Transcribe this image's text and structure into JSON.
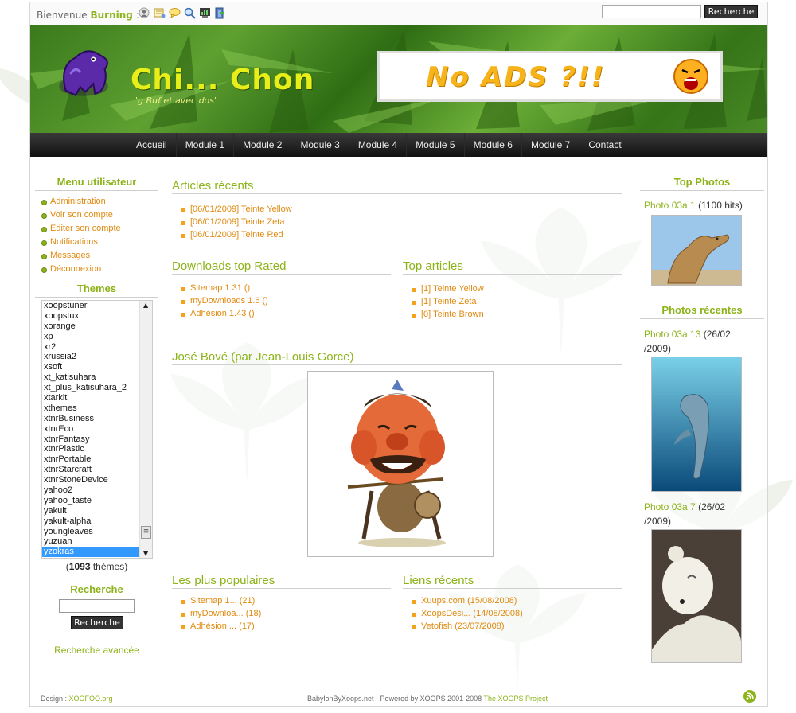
{
  "topbar": {
    "welcome_prefix": "Bienvenue",
    "welcome_user": "Burning",
    "welcome_suffix": ":",
    "search_placeholder": "",
    "search_button": "Recherche",
    "icons": [
      "profile-icon",
      "inbox-icon",
      "chat-icon",
      "search-icon",
      "stats-icon",
      "logout-icon"
    ]
  },
  "header": {
    "site_name": "Chi... Chon",
    "slogan": "\"g Buf et avec dos\"",
    "banner_text": "No ADS ?!!"
  },
  "nav": [
    "Accueil",
    "Module 1",
    "Module 2",
    "Module 3",
    "Module 4",
    "Module 5",
    "Module 6",
    "Module 7",
    "Contact"
  ],
  "left": {
    "user_menu_title": "Menu utilisateur",
    "user_menu": [
      "Administration",
      "Voir son compte",
      "Editer son compte",
      "Notifications",
      "Messages",
      "Déconnexion"
    ],
    "themes_title": "Themes",
    "themes": [
      "xoopstuner",
      "xoopstux",
      "xorange",
      "xp",
      "xr2",
      "xrussia2",
      "xsoft",
      "xt_katisuhara",
      "xt_plus_katisuhara_2",
      "xtarkit",
      "xthemes",
      "xtnrBusiness",
      "xtnrEco",
      "xtnrFantasy",
      "xtnrPlastic",
      "xtnrPortable",
      "xtnrStarcraft",
      "xtnrStoneDevice",
      "yahoo2",
      "yahoo_taste",
      "yakult",
      "yakult-alpha",
      "youngleaves",
      "yuzuan",
      "yzokras"
    ],
    "themes_selected": "yzokras",
    "themes_count_open": "(",
    "themes_count": "1093",
    "themes_count_label": "thèmes)",
    "search_title": "Recherche",
    "search_button": "Recherche",
    "advanced_search": "Recherche avancée"
  },
  "center": {
    "recent_title": "Articles récents",
    "recent": [
      {
        "date": "[06/01/2009]",
        "title": "Teinte Yellow"
      },
      {
        "date": "[06/01/2009]",
        "title": "Teinte Zeta"
      },
      {
        "date": "[06/01/2009]",
        "title": "Teinte Red"
      }
    ],
    "downloads_title": "Downloads top Rated",
    "downloads": [
      "Sitemap 1.31 ()",
      "myDownloads 1.6 ()",
      "Adhésion 1.43 ()"
    ],
    "top_articles_title": "Top articles",
    "top_articles": [
      {
        "rank": "[1]",
        "title": "Teinte Yellow"
      },
      {
        "rank": "[1]",
        "title": "Teinte Zeta"
      },
      {
        "rank": "[0]",
        "title": "Teinte Brown"
      }
    ],
    "bove_title": "José Bové (par Jean-Louis Gorce)",
    "popular_title": "Les plus populaires",
    "popular": [
      "Sitemap 1... (21)",
      "myDownloa... (18)",
      "Adhésion ... (17)"
    ],
    "links_title": "Liens récents",
    "links": [
      "Xuups.com (15/08/2008)",
      "XoopsDesi... (14/08/2008)",
      "Vetofish (23/07/2008)"
    ]
  },
  "right": {
    "top_photos_title": "Top Photos",
    "top_photo_name": "Photo 03a 1",
    "top_photo_hits": "(1100 hits)",
    "recent_photos_title": "Photos récentes",
    "recent_photo1_name": "Photo 03a 13",
    "recent_photo1_date_a": "(26/02",
    "recent_photo1_date_b": "/2009)",
    "recent_photo2_name": "Photo 03a 7",
    "recent_photo2_date_a": "(26/02",
    "recent_photo2_date_b": "/2009)"
  },
  "footer": {
    "design_label": "Design :",
    "design_link": "XOOFOO.org",
    "powered": "BabylonByXoops.net - Powered by XOOPS 2001-2008",
    "xoops_link": "The XOOPS Project"
  },
  "colors": {
    "accent": "#8cb319",
    "link_orange": "#e08a10",
    "nav_bg": "#1a1a1a"
  }
}
